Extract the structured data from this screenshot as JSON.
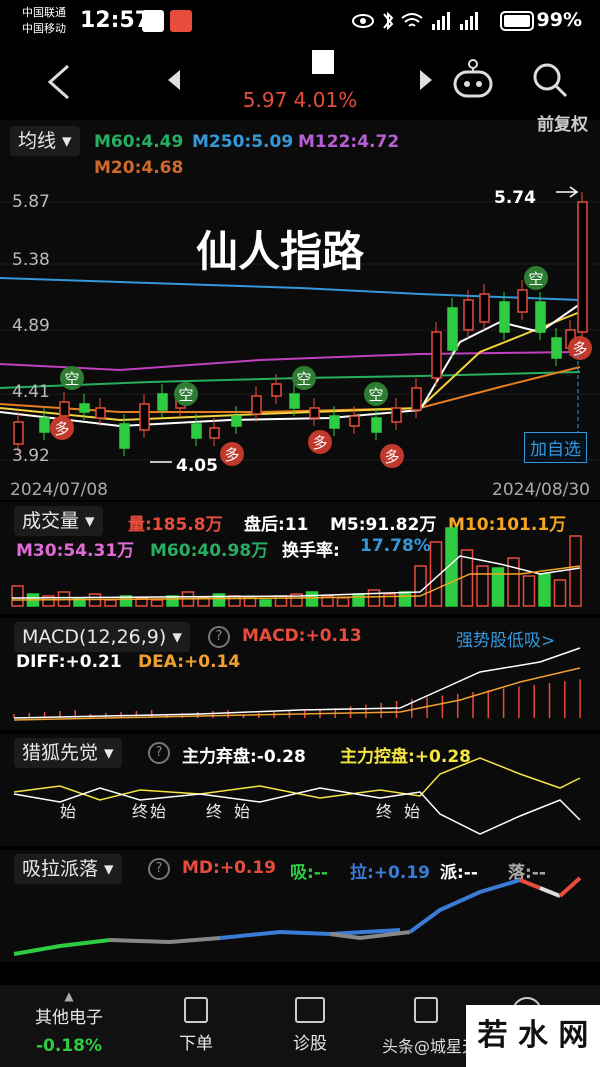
{
  "status": {
    "carrier1": "中国联通",
    "carrier2": "中国移动",
    "time": "12:57",
    "battery": "99%"
  },
  "nav": {
    "price_change": "5.97 4.01%"
  },
  "ma_panel": {
    "selector": "均线",
    "top_right": "前复权",
    "m60": "M60:4.49",
    "m250": "M250:5.09",
    "m122": "M122:4.72",
    "m20": "M20:4.68"
  },
  "kline": {
    "title": "仙人指路",
    "y_labels": [
      "5.87",
      "5.38",
      "4.89",
      "4.41",
      "3.92"
    ],
    "high_label": "5.74",
    "low_label": "4.05",
    "date_start": "2024/07/08",
    "date_end": "2024/08/30",
    "add_watch": "加自选",
    "signal_kong": "空",
    "signal_duo": "多",
    "colors": {
      "up": "#e74c3c",
      "down": "#2ecc40",
      "m5": "#ffffff",
      "m10": "#f5d23b",
      "m20": "#e67e22",
      "m30": "#c040c0",
      "m60": "#27ae60",
      "m250": "#3498db",
      "m122": "#9b59b6"
    }
  },
  "volume": {
    "selector": "成交量",
    "vol": "量:185.8万",
    "after_hours": "盘后:11",
    "m5": "M5:91.82万",
    "m10": "M10:101.1万",
    "m30": "M30:54.31万",
    "m60": "M60:40.98万",
    "turnover_label": "换手率:",
    "turnover_value": "17.78%"
  },
  "macd": {
    "selector": "MACD(12,26,9)",
    "macd": "MACD:+0.13",
    "link": "强势股低吸>",
    "diff": "DIFF:+0.21",
    "dea": "DEA:+0.14"
  },
  "hunter": {
    "selector": "猎狐先觉",
    "abandon": "主力弃盘:-0.28",
    "control": "主力控盘:+0.28",
    "marks": [
      "始",
      "终",
      "始",
      "终",
      "始",
      "终",
      "始"
    ]
  },
  "xlp": {
    "selector": "吸拉派落",
    "md": "MD:+0.19",
    "xi": "吸:--",
    "la": "拉:+0.19",
    "pai": "派:--",
    "luo": "落:--"
  },
  "bottom": {
    "sector": "其他电子",
    "sector_change": "-0.18%",
    "order": "下单",
    "diagnose": "诊股",
    "watermark": "头条@城星天",
    "logo": "若 水 网"
  }
}
